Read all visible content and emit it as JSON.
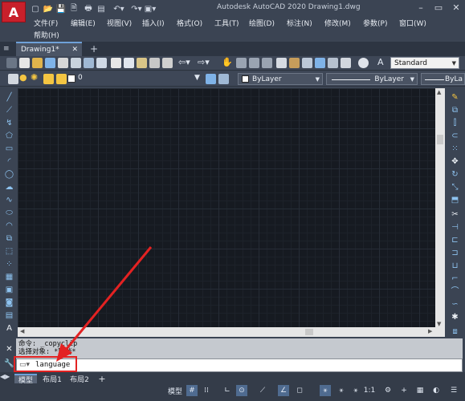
{
  "window": {
    "title": "Autodesk AutoCAD 2020    Drawing1.dwg",
    "controls": [
      "–",
      "▭",
      "✕"
    ]
  },
  "logo": {
    "letter": "A"
  },
  "menu": [
    "文件(F)",
    "编辑(E)",
    "视图(V)",
    "插入(I)",
    "格式(O)",
    "工具(T)",
    "绘图(D)",
    "标注(N)",
    "修改(M)",
    "参数(P)",
    "窗口(W)",
    "帮助(H)"
  ],
  "tabs": {
    "active": "Drawing1*",
    "close": "✕",
    "add": "+"
  },
  "toolbar": {
    "text_style": "Standard",
    "layer_name": "0",
    "color": "ByLayer",
    "linetype": "ByLayer",
    "lineweight": "ByLa"
  },
  "command": {
    "history": [
      "命令: _copyclip",
      "选择对象: *取消*"
    ],
    "input": "language",
    "input_icon": "terminal-icon"
  },
  "layout_tabs": [
    "模型",
    "布局1",
    "布局2",
    "+"
  ],
  "status": {
    "model": "模型",
    "scale": "1:1"
  },
  "colors": {
    "annotation_arrow": "#e32222",
    "highlight_box": "#e32222",
    "canvas_bg": "#161a21"
  }
}
